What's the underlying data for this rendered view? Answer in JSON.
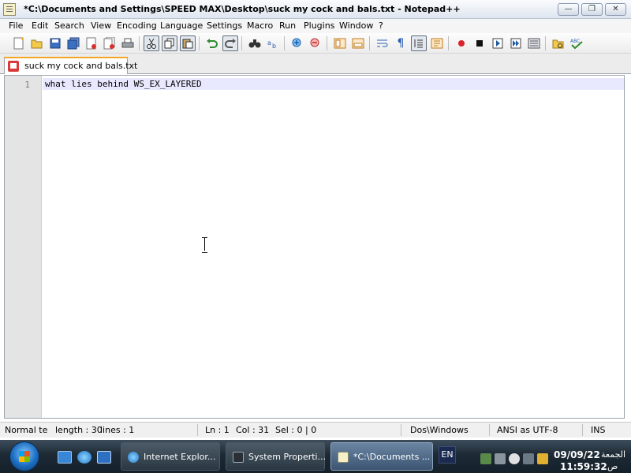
{
  "window": {
    "title": "*C:\\Documents and Settings\\SPEED MAX\\Desktop\\suck my cock and bals.txt - Notepad++",
    "minimize_glyph": "—",
    "maximize_glyph": "❐",
    "close_glyph": "✕"
  },
  "menu": {
    "items": [
      "File",
      "Edit",
      "Search",
      "View",
      "Encoding",
      "Language",
      "Settings",
      "Macro",
      "Run",
      "Plugins",
      "Window",
      "?"
    ]
  },
  "toolbar": {
    "icons": [
      "new-file-icon",
      "open-file-icon",
      "save-icon",
      "save-all-icon",
      "close-icon",
      "close-all-icon",
      "print-icon",
      "cut-icon",
      "copy-icon",
      "paste-icon",
      "undo-icon",
      "redo-icon",
      "find-icon",
      "replace-icon",
      "zoom-in-icon",
      "zoom-out-icon",
      "sync-vertical-icon",
      "sync-horizontal-icon",
      "word-wrap-icon",
      "show-all-chars-icon",
      "indent-guide-icon",
      "doc-map-icon",
      "record-macro-icon",
      "stop-macro-icon",
      "play-macro-icon",
      "run-macro-multiple-icon",
      "save-macro-icon",
      "open-folder-icon",
      "spell-check-icon"
    ]
  },
  "tab": {
    "label": "suck my cock and bals.txt",
    "modified_color": "#d93a3a"
  },
  "editor": {
    "lines": [
      {
        "number": "1",
        "text": "what lies behind WS_EX_LAYERED"
      }
    ],
    "current_line_color": "#e8e8ff"
  },
  "statusbar": {
    "doc_type": "Normal te",
    "length": "length : 30",
    "lines": "lines : 1",
    "ln": "Ln : 1",
    "col": "Col : 31",
    "sel": "Sel : 0 | 0",
    "eol": "Dos\\Windows",
    "encoding": "ANSI as UTF-8",
    "mode": "INS"
  },
  "taskbar": {
    "tasks": [
      {
        "label": "Internet Explor...",
        "icon": "internet-explorer-icon"
      },
      {
        "label": "System Properti...",
        "icon": "system-properties-icon"
      },
      {
        "label": "*C:\\Documents ...",
        "icon": "notepadpp-icon"
      }
    ],
    "language": "EN",
    "clock": {
      "date": "09/09/22",
      "day": "الجمعة",
      "time": "11:59:32",
      "ampm": "ص"
    }
  }
}
